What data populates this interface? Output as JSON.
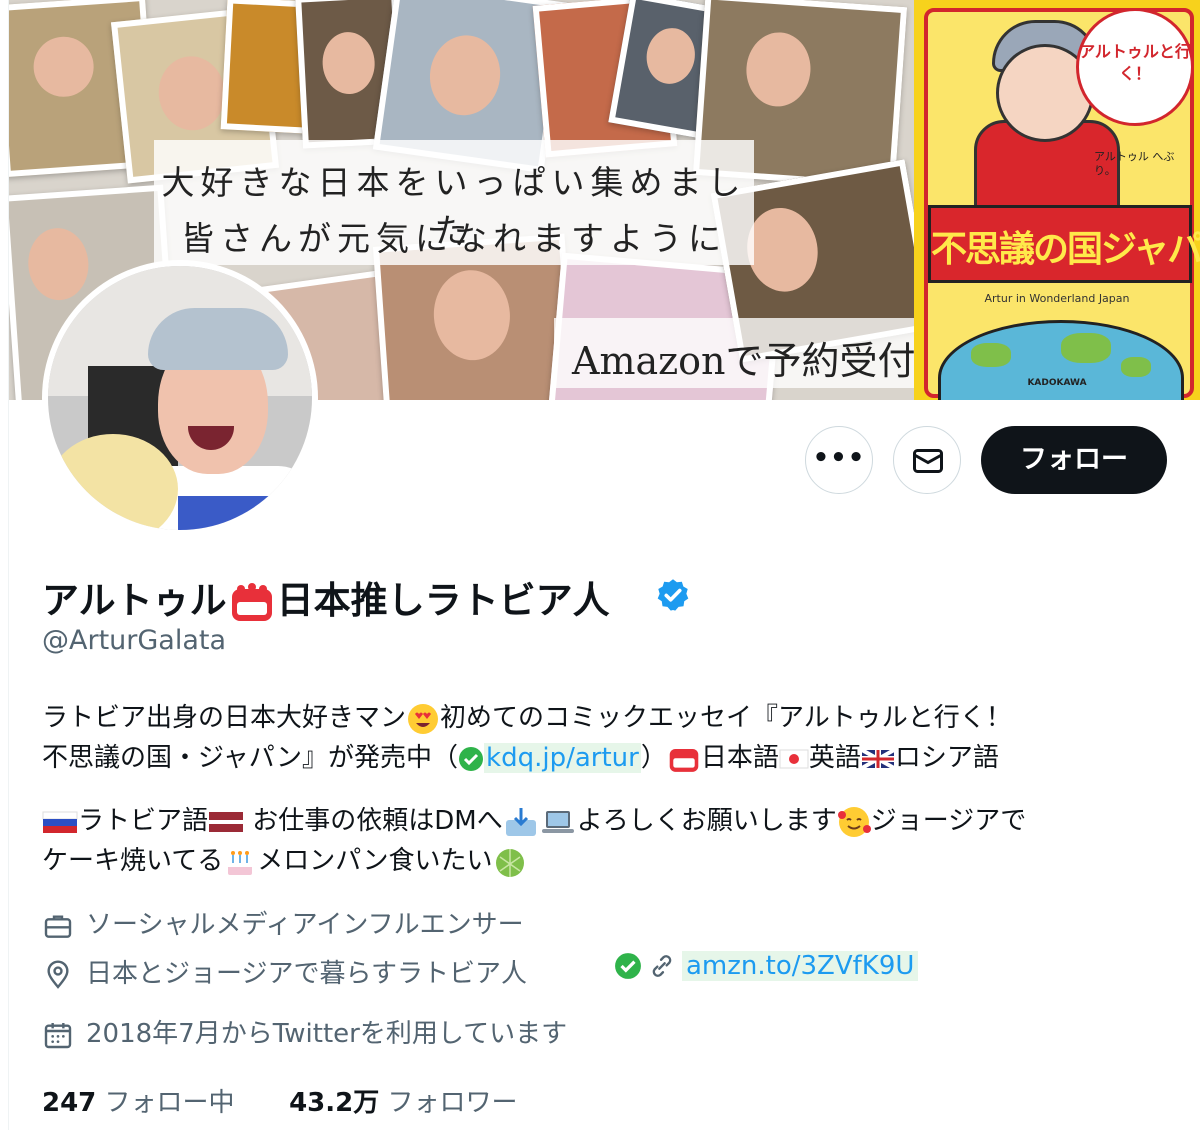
{
  "banner": {
    "caption_line1": "大好きな日本をいっぱい集めました",
    "caption_line2": "皆さんが元気になれますように",
    "amazon_text": "Amazonで予約受付中",
    "book": {
      "badge_text": "アルトゥルと行く！",
      "author_text": "アルトゥル へぶり。",
      "title": "不思議の国ジャパン",
      "english_title": "Artur in Wonderland Japan",
      "publisher": "KADOKAWA",
      "colors": {
        "cover": "#f7d21c",
        "accent": "#d2262d"
      }
    }
  },
  "actions": {
    "more_icon": "more-horizontal-icon",
    "more_label": "•••",
    "message_icon": "envelope-icon",
    "follow_label": "フォロー"
  },
  "profile": {
    "display_name_part1": "アルトゥル",
    "display_name_part2": "日本推しラトビア人",
    "name_emoji": "calendar-emoji",
    "verified_icon": "verified-badge-icon",
    "verified_color": "#1d9bf0",
    "handle": "@ArturGalata"
  },
  "bio": {
    "line1_a": "ラトビア出身の日本大好きマン",
    "line1_b": "初めてのコミックエッセイ『アルトゥルと行く！",
    "line2_a": "不思議の国・ジャパン』が発売中（",
    "line2_link": "kdq.jp/artur",
    "line2_b": "）",
    "line2_c": "日本語",
    "line2_d": "英語",
    "line2_e": "ロシア語",
    "line3_a": "ラトビア語",
    "line3_b": " お仕事の依頼はDMへ",
    "line3_c": "よろしくお願いします",
    "line3_d": "ジョージアで",
    "line4_a": "ケーキ焼いてる",
    "line4_b": "メロンパン食いたい"
  },
  "meta": {
    "category_icon": "briefcase-icon",
    "category": "ソーシャルメディアインフルエンサー",
    "location_icon": "location-pin-icon",
    "location": "日本とジョージアで暮らすラトビア人",
    "link_icon": "link-icon",
    "link": "amzn.to/3ZVfK9U",
    "joined_icon": "calendar-icon",
    "joined": "2018年7月からTwitterを利用しています"
  },
  "stats": {
    "following_count": "247",
    "following_label": "フォロー中",
    "followers_count": "43.2万",
    "followers_label": "フォロワー"
  }
}
